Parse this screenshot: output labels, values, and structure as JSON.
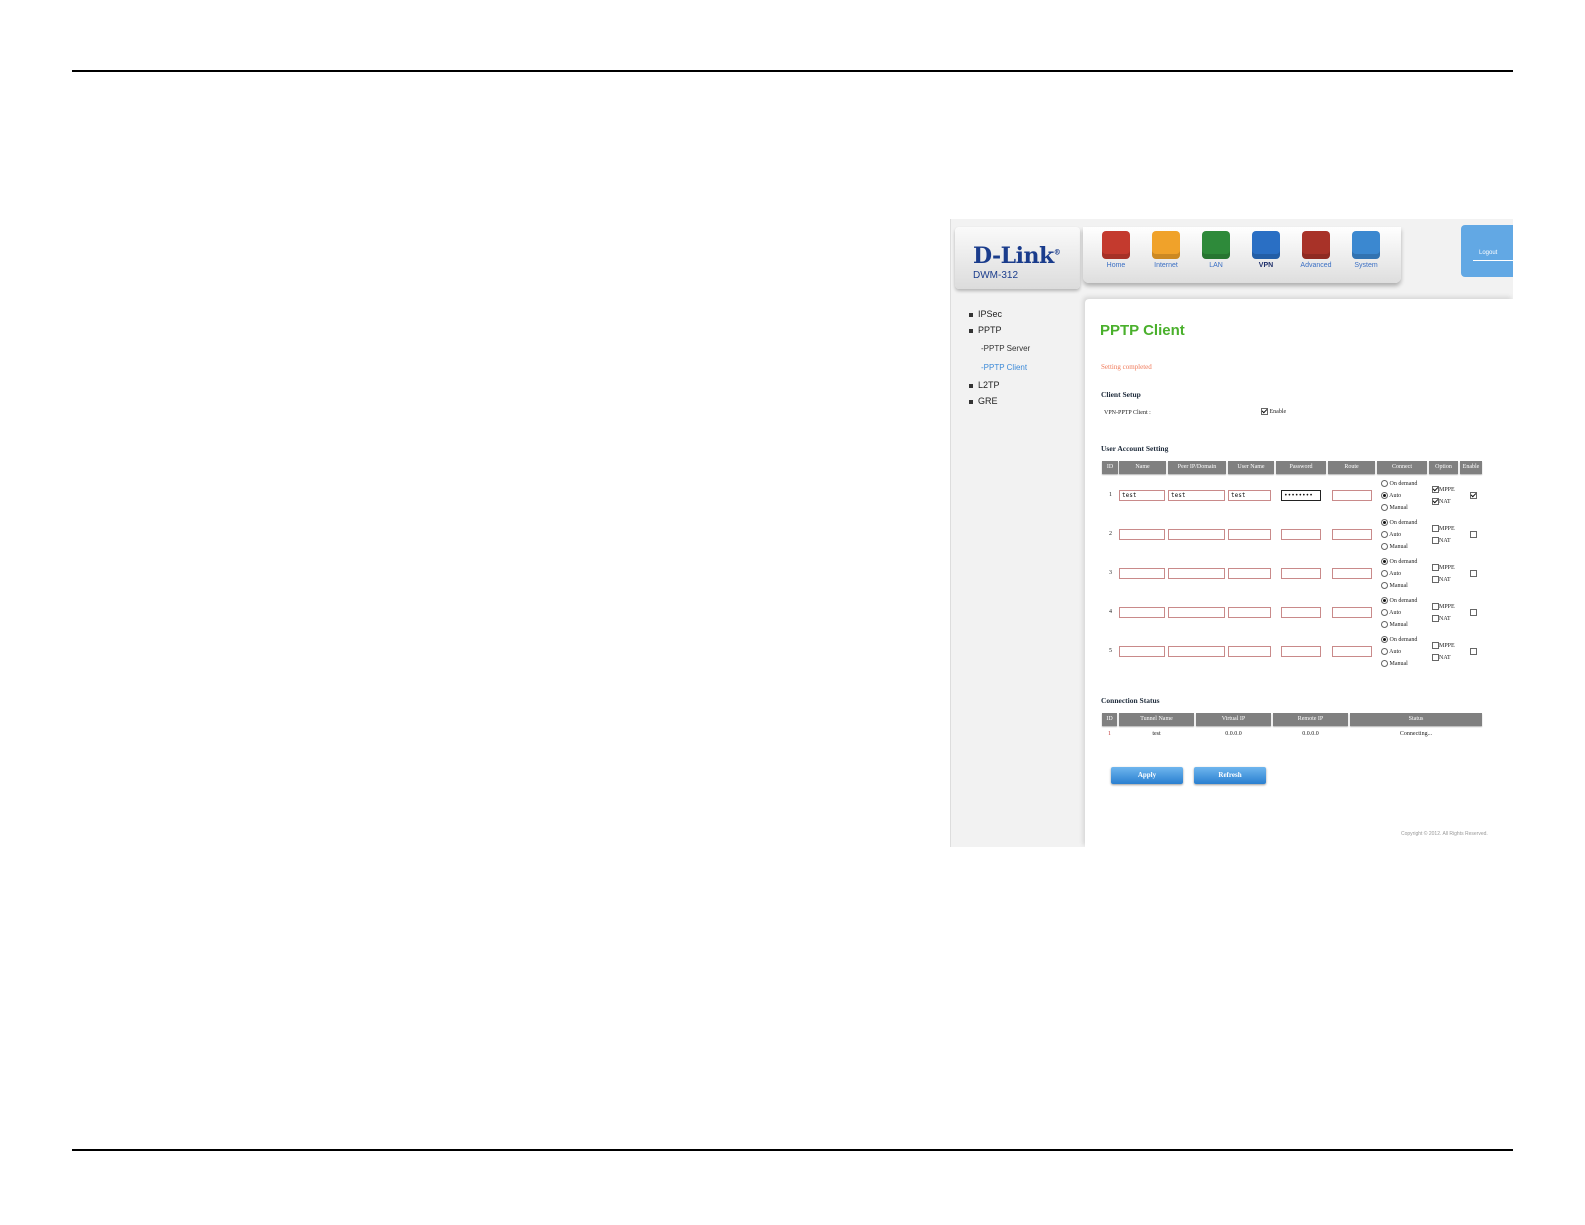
{
  "brand": {
    "logo": "D-Link",
    "registered": "®",
    "model": "DWM-312"
  },
  "nav": [
    {
      "label": "Home",
      "icon": "home-icon",
      "color": "#c43a2e"
    },
    {
      "label": "Internet",
      "icon": "globe-icon",
      "color": "#f0a22a"
    },
    {
      "label": "LAN",
      "icon": "lan-icon",
      "color": "#2e8a3a"
    },
    {
      "label": "VPN",
      "icon": "vpn-lock-icon",
      "color": "#2a6fc4",
      "active": true
    },
    {
      "label": "Advanced",
      "icon": "tools-icon",
      "color": "#a83228"
    },
    {
      "label": "System",
      "icon": "monitor-icon",
      "color": "#3b88d0"
    }
  ],
  "logout_label": "Logout",
  "sidebar": {
    "items": [
      {
        "label": "IPSec"
      },
      {
        "label": "PPTP"
      },
      {
        "label": "-PPTP Server"
      },
      {
        "label": "-PPTP Client"
      },
      {
        "label": "L2TP"
      },
      {
        "label": "GRE"
      }
    ]
  },
  "page_title": "PPTP Client",
  "status_message": "Setting completed",
  "client_setup": {
    "heading": "Client Setup",
    "label": "VPN-PPTP Client :",
    "enable_label": "Enable",
    "enabled": true
  },
  "user_accounts": {
    "heading": "User Account Setting",
    "columns": [
      "ID",
      "Name",
      "Peer IP/Domain",
      "User Name",
      "Password",
      "Route",
      "Connect",
      "Option",
      "Enable"
    ],
    "connect_options": [
      "On demand",
      "Auto",
      "Manual"
    ],
    "option_labels": [
      "MPPE",
      "NAT"
    ],
    "rows": [
      {
        "id": "1",
        "name": "test",
        "peer": "test",
        "user": "test",
        "password": "••••••••",
        "route": "",
        "connect": "Auto",
        "mppe": true,
        "nat": true,
        "enable": true
      },
      {
        "id": "2",
        "name": "",
        "peer": "",
        "user": "",
        "password": "",
        "route": "",
        "connect": "On demand",
        "mppe": false,
        "nat": false,
        "enable": false
      },
      {
        "id": "3",
        "name": "",
        "peer": "",
        "user": "",
        "password": "",
        "route": "",
        "connect": "On demand",
        "mppe": false,
        "nat": false,
        "enable": false
      },
      {
        "id": "4",
        "name": "",
        "peer": "",
        "user": "",
        "password": "",
        "route": "",
        "connect": "On demand",
        "mppe": false,
        "nat": false,
        "enable": false
      },
      {
        "id": "5",
        "name": "",
        "peer": "",
        "user": "",
        "password": "",
        "route": "",
        "connect": "On demand",
        "mppe": false,
        "nat": false,
        "enable": false
      }
    ]
  },
  "connection_status": {
    "heading": "Connection Status",
    "columns": [
      "ID",
      "Tunnel Name",
      "Virtual IP",
      "Remote IP",
      "Status"
    ],
    "rows": [
      {
        "id": "1",
        "tunnel": "test",
        "virtual_ip": "0.0.0.0",
        "remote_ip": "0.0.0.0",
        "status": "Connecting..."
      }
    ]
  },
  "buttons": {
    "apply": "Apply",
    "refresh": "Refresh"
  },
  "copyright": "Copyright © 2012. All Rights Reserved."
}
